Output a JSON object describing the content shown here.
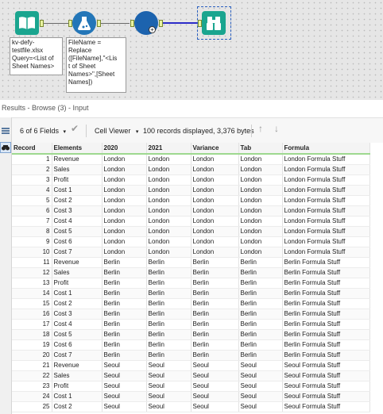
{
  "workflow": {
    "input_annotation": "kv-defy-\ntestfile.xlsx\nQuery=<List of\nSheet Names>",
    "formula_annotation": "FileName =\nReplace\n([FileName],\"<Lis\nt of Sheet\nNames>\",[Sheet\nNames])",
    "tools": {
      "input": "input-data-icon",
      "formula": "formula-icon",
      "dynamic_input": "dynamic-input-icon",
      "browse": "browse-binoculars-icon"
    }
  },
  "results": {
    "title": "Results - Browse (3) - Input",
    "fields_selector": "6 of 6 Fields",
    "viewer": "Cell Viewer",
    "records_info": "100 records displayed, 3,376 bytes"
  },
  "columns": [
    "Record",
    "Elements",
    "2020",
    "2021",
    "Variance",
    "Tab",
    "Formula"
  ],
  "rows": [
    [
      "1",
      "Revenue",
      "London",
      "London",
      "London",
      "London",
      "London Formula Stuff"
    ],
    [
      "2",
      "Sales",
      "London",
      "London",
      "London",
      "London",
      "London Formula Stuff"
    ],
    [
      "3",
      "Profit",
      "London",
      "London",
      "London",
      "London",
      "London Formula Stuff"
    ],
    [
      "4",
      "Cost 1",
      "London",
      "London",
      "London",
      "London",
      "London Formula Stuff"
    ],
    [
      "5",
      "Cost 2",
      "London",
      "London",
      "London",
      "London",
      "London Formula Stuff"
    ],
    [
      "6",
      "Cost 3",
      "London",
      "London",
      "London",
      "London",
      "London Formula Stuff"
    ],
    [
      "7",
      "Cost 4",
      "London",
      "London",
      "London",
      "London",
      "London Formula Stuff"
    ],
    [
      "8",
      "Cost 5",
      "London",
      "London",
      "London",
      "London",
      "London Formula Stuff"
    ],
    [
      "9",
      "Cost 6",
      "London",
      "London",
      "London",
      "London",
      "London Formula Stuff"
    ],
    [
      "10",
      "Cost 7",
      "London",
      "London",
      "London",
      "London",
      "London Formula Stuff"
    ],
    [
      "11",
      "Revenue",
      "Berlin",
      "Berlin",
      "Berlin",
      "Berlin",
      "Berlin Formula Stuff"
    ],
    [
      "12",
      "Sales",
      "Berlin",
      "Berlin",
      "Berlin",
      "Berlin",
      "Berlin Formula Stuff"
    ],
    [
      "13",
      "Profit",
      "Berlin",
      "Berlin",
      "Berlin",
      "Berlin",
      "Berlin Formula Stuff"
    ],
    [
      "14",
      "Cost 1",
      "Berlin",
      "Berlin",
      "Berlin",
      "Berlin",
      "Berlin Formula Stuff"
    ],
    [
      "15",
      "Cost 2",
      "Berlin",
      "Berlin",
      "Berlin",
      "Berlin",
      "Berlin Formula Stuff"
    ],
    [
      "16",
      "Cost 3",
      "Berlin",
      "Berlin",
      "Berlin",
      "Berlin",
      "Berlin Formula Stuff"
    ],
    [
      "17",
      "Cost 4",
      "Berlin",
      "Berlin",
      "Berlin",
      "Berlin",
      "Berlin Formula Stuff"
    ],
    [
      "18",
      "Cost 5",
      "Berlin",
      "Berlin",
      "Berlin",
      "Berlin",
      "Berlin Formula Stuff"
    ],
    [
      "19",
      "Cost 6",
      "Berlin",
      "Berlin",
      "Berlin",
      "Berlin",
      "Berlin Formula Stuff"
    ],
    [
      "20",
      "Cost 7",
      "Berlin",
      "Berlin",
      "Berlin",
      "Berlin",
      "Berlin Formula Stuff"
    ],
    [
      "21",
      "Revenue",
      "Seoul",
      "Seoul",
      "Seoul",
      "Seoul",
      "Seoul Formula Stuff"
    ],
    [
      "22",
      "Sales",
      "Seoul",
      "Seoul",
      "Seoul",
      "Seoul",
      "Seoul Formula Stuff"
    ],
    [
      "23",
      "Profit",
      "Seoul",
      "Seoul",
      "Seoul",
      "Seoul",
      "Seoul Formula Stuff"
    ],
    [
      "24",
      "Cost 1",
      "Seoul",
      "Seoul",
      "Seoul",
      "Seoul",
      "Seoul Formula Stuff"
    ],
    [
      "25",
      "Cost 2",
      "Seoul",
      "Seoul",
      "Seoul",
      "Seoul",
      "Seoul Formula Stuff"
    ]
  ],
  "colors": {
    "tool_green": "#1aa58f",
    "tool_blue": "#2376b8",
    "header_underline": "#9ed98f",
    "selection_border": "#2a5fbf"
  }
}
